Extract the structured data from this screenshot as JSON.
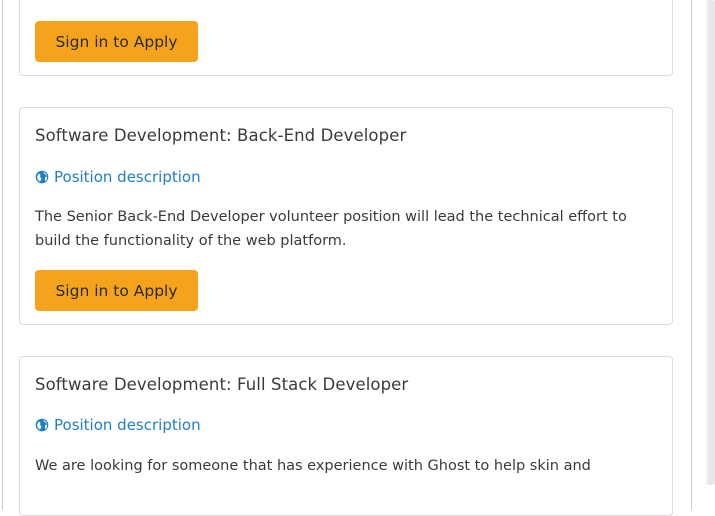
{
  "cards": [
    {
      "partial_text": "... …",
      "apply_label": "Sign in to Apply"
    },
    {
      "title": "Software Development: Back-End Developer",
      "link_label": "Position description",
      "description": "The Senior Back-End Developer volunteer position will lead the technical effort to build the functionality of the web platform.",
      "apply_label": "Sign in to Apply"
    },
    {
      "title": "Software Development: Full Stack Developer",
      "link_label": "Position description",
      "description": "We are looking for someone that has experience with Ghost to help skin and"
    }
  ],
  "colors": {
    "accent": "#f5a31d",
    "link": "#1f7fc7",
    "border": "#d9dce0"
  },
  "icons": {
    "position_link": "globe-icon"
  }
}
